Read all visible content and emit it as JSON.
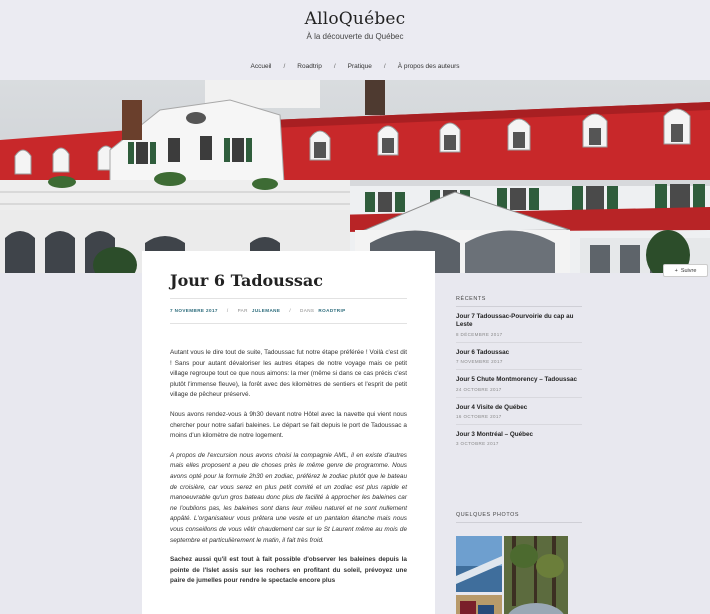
{
  "site": {
    "title": "AlloQuébec",
    "tagline": "À la découverte du Québec"
  },
  "nav": {
    "items": [
      "Accueil",
      "Roadtrip",
      "Pratique",
      "À propos des auteurs"
    ],
    "separator": "/"
  },
  "follow": {
    "label": "Suivre",
    "icon": "plus-icon"
  },
  "post": {
    "title": "Jour 6 Tadoussac",
    "date": "7 novembre 2017",
    "by_prefix": "par",
    "author": "julemane",
    "in_prefix": "dans",
    "category": "roadtrip",
    "paragraphs": [
      "Autant vous le dire tout de suite, Tadoussac fut notre étape préférée ! Voilà c'est dit ! Sans pour autant dévaloriser les autres étapes de notre voyage mais ce petit village regroupe tout ce que nous aimons: la mer (même si dans ce cas précis c'est plutôt l'immense fleuve), la forêt avec des kilomètres de sentiers et l'esprit de petit village de pêcheur préservé.",
      "Nous avons rendez-vous à 9h30 devant notre Hôtel avec la navette qui vient nous chercher pour notre safari baleines. Le départ se fait depuis le port de Tadoussac a moins d'un kilomètre de notre logement.",
      "A propos de l'excursion nous avons choisi la compagnie AML, il en existe d'autres mais elles proposent a peu de choses près le même genre de programme. Nous avons opté pour la formule 2h30 en zodiac, préférez le zodiac plutôt que le bateau de croisière, car vous serez en plus petit comité et un zodiac est  plus rapide et manoeuvrable qu'un gros bateau donc plus de facilité à approcher les baleines car ne l'oublions pas,  les baleines sont dans leur milieu naturel et ne sont nullement appâté. L'organisateur vous prêtera une veste et un pantalon étanche mais nous vous conseillons de vous vêtir chaudement car sur le St Laurent même au mois de septembre et particulièrement le matin, il fait très froid.",
      "Sachez aussi qu'il est tout à fait possible d'observer les baleines depuis la pointe de l'Islet assis sur les rochers en profitant du soleil, prévoyez une paire de jumelles pour rendre le spectacle encore plus"
    ]
  },
  "sidebar": {
    "recent_title": "Récents",
    "recent": [
      {
        "title": "Jour 7 Tadoussac-Pourvoirie du cap au Leste",
        "date": "8 décembre 2017"
      },
      {
        "title": "Jour 6 Tadoussac",
        "date": "7 novembre 2017"
      },
      {
        "title": "Jour 5 Chute Montmorency – Tadoussac",
        "date": "24 octobre 2017"
      },
      {
        "title": "Jour 4 Visite de Québec",
        "date": "16 octobre 2017"
      },
      {
        "title": "Jour 3 Montréal – Québec",
        "date": "3 octobre 2017"
      }
    ],
    "photos_title": "Quelques photos"
  },
  "colors": {
    "header_bg": "#ebebf2",
    "roof_red": "#c8282a",
    "meta_link": "#2a6a7a"
  }
}
